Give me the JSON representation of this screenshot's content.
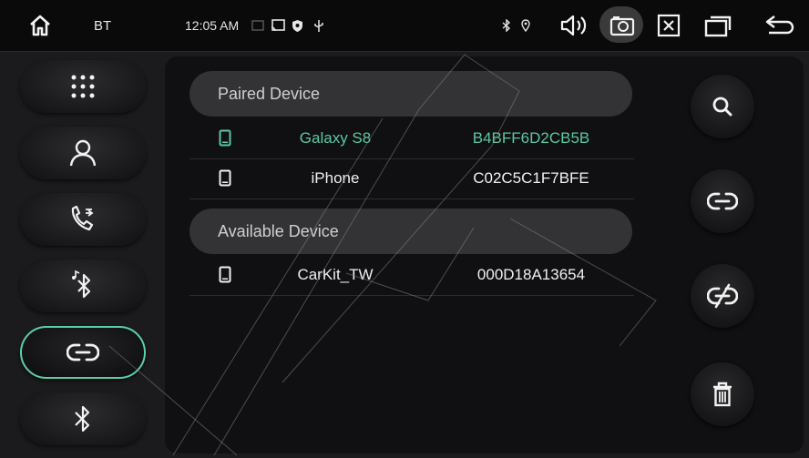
{
  "statusbar": {
    "label": "BT",
    "time": "12:05 AM",
    "icons": [
      "home-icon",
      "cast-icon",
      "shield-icon",
      "usb-icon",
      "bluetooth-status-icon",
      "location-icon",
      "volume-icon",
      "screenshot-icon",
      "close-window-icon",
      "multiwindow-icon",
      "back-icon"
    ]
  },
  "sidebar": {
    "items": [
      {
        "icon": "dialpad-icon"
      },
      {
        "icon": "contacts-icon"
      },
      {
        "icon": "call-log-icon"
      },
      {
        "icon": "bluetooth-music-icon"
      },
      {
        "icon": "link-icon",
        "active": true
      },
      {
        "icon": "bluetooth-icon"
      }
    ]
  },
  "paired": {
    "header": "Paired Device",
    "devices": [
      {
        "name": "Galaxy S8",
        "mac": "B4BFF6D2CB5B",
        "connected": true
      },
      {
        "name": "iPhone",
        "mac": "C02C5C1F7BFE",
        "connected": false
      }
    ]
  },
  "available": {
    "header": "Available Device",
    "devices": [
      {
        "name": "CarKit_TW",
        "mac": "000D18A13654"
      }
    ]
  },
  "actions": [
    "search-icon",
    "connect-icon",
    "disconnect-icon",
    "delete-icon"
  ],
  "colors": {
    "accent": "#5ad1a4",
    "connected": "#5ac8a0"
  }
}
